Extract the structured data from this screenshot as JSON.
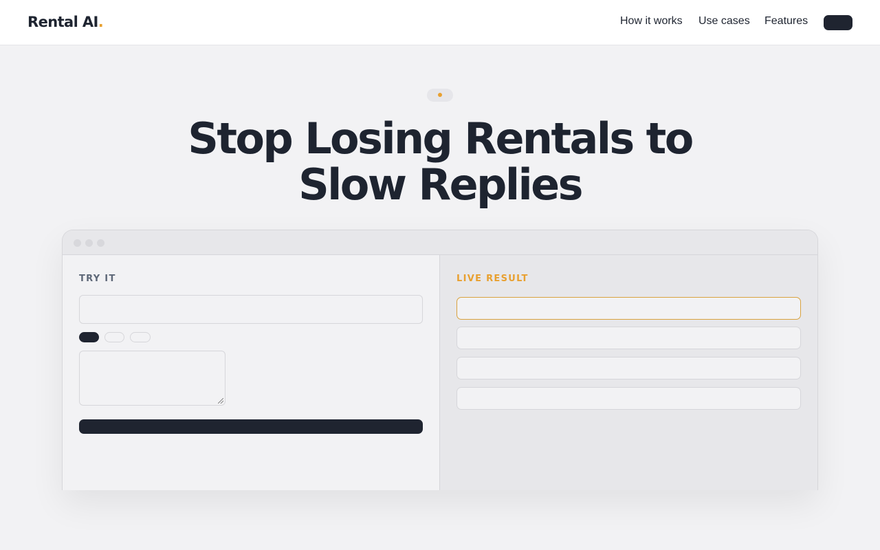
{
  "header": {
    "logo_text": "Rental AI",
    "logo_dot": ".",
    "nav": [
      "How it works",
      "Use cases",
      "Features"
    ],
    "cta_label": ""
  },
  "hero": {
    "badge_text": "",
    "headline_line1": "Stop Losing Rentals to",
    "headline_line2": "Slow Replies"
  },
  "demo": {
    "left": {
      "label": "TRY IT",
      "input_value": "",
      "chips": [
        "",
        "",
        ""
      ],
      "selected_chip": 0,
      "message_value": "",
      "submit_label": ""
    },
    "right": {
      "label": "LIVE RESULT",
      "results": [
        "",
        "",
        "",
        ""
      ],
      "active_result": 0
    }
  },
  "colors": {
    "accent": "#e8a030",
    "dark": "#1f2430",
    "background": "#f2f2f4",
    "muted_label": "#5e6878"
  }
}
